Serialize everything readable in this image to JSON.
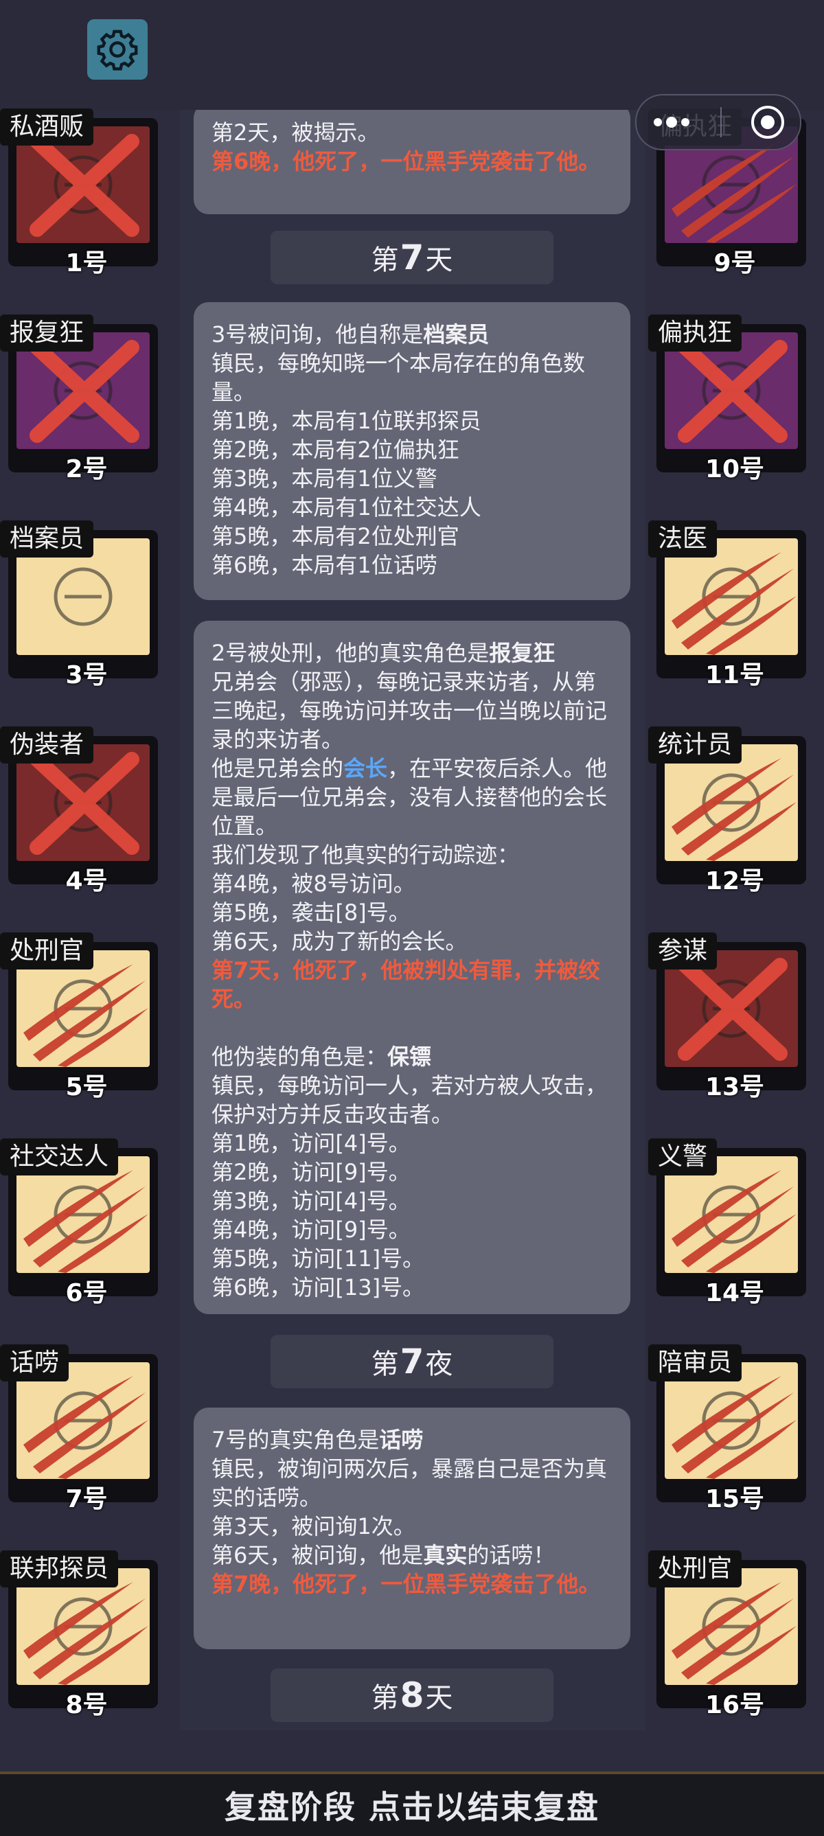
{
  "menu_capsule": {
    "more_icon": "more-dots-icon",
    "close_icon": "target-close-icon"
  },
  "settings_icon": "gear-icon",
  "log": {
    "msg_top": {
      "line1": "第2天，被揭示。",
      "line2": "第6晚，他死了，一位黑手党袭击了他。"
    },
    "day7_label": {
      "prefix": "第",
      "n": "7",
      "suffix": "天"
    },
    "msg_archivist": {
      "lines_a": "3号被问询，他自称是",
      "role": "档案员",
      "desc": "镇民，每晚知晓一个本局存在的角色数量。",
      "entries": [
        "第1晚，本局有1位联邦探员",
        "第2晚，本局有2位偏执狂",
        "第3晚，本局有1位义警",
        "第4晚，本局有1位社交达人",
        "第5晚，本局有2位处刑官",
        "第6晚，本局有1位话唠"
      ]
    },
    "msg_avenger": {
      "intro": "2号被处刑，他的真实角色是",
      "role": "报复狂",
      "desc": "兄弟会（邪恶），每晚记录来访者，从第三晚起，每晚访问并攻击一位当晚以前记录的来访者。",
      "leader_a": "他是兄弟会的",
      "leader_role": "会长",
      "leader_b": "，在平安夜后杀人。他是最后一位兄弟会，没有人接替他的会长位置。",
      "track_title": "我们发现了他真实的行动踪迹：",
      "track": [
        "第4晚，被8号访问。",
        "第5晚，袭击[8]号。",
        "第6天，成为了新的会长。"
      ],
      "death": "第7天，他死了，他被判处有罪，并被绞死。",
      "fake_intro": "他伪装的角色是：",
      "fake_role": "保镖",
      "fake_desc": "镇民，每晚访问一人，若对方被人攻击，保护对方并反击攻击者。",
      "fake_track": [
        "第1晚，访问[4]号。",
        "第2晚，访问[9]号。",
        "第3晚，访问[4]号。",
        "第4晚，访问[9]号。",
        "第5晚，访问[11]号。",
        "第6晚，访问[13]号。"
      ]
    },
    "night7_label": {
      "prefix": "第",
      "n": "7",
      "suffix": "夜"
    },
    "msg_chatter": {
      "intro": "7号的真实角色是",
      "role": "话唠",
      "desc": "镇民，被询问两次后，暴露自己是否为真实的话唠。",
      "line1": "第3天，被问询1次。",
      "line2a": "第6天，被问询，他是",
      "line2b": "真实",
      "line2c": "的话唠！",
      "death": "第7晚，他死了，一位黑手党袭击了他。"
    },
    "day8_label": {
      "prefix": "第",
      "n": "8",
      "suffix": "天"
    }
  },
  "players_left": [
    {
      "role": "私酒贩",
      "num": "1号",
      "bg": "maroon",
      "status": "crossed",
      "icon": "bootlegger-icon"
    },
    {
      "role": "报复狂",
      "num": "2号",
      "bg": "purple",
      "status": "crossed",
      "icon": "book-icon"
    },
    {
      "role": "档案员",
      "num": "3号",
      "bg": "cream",
      "status": "alive",
      "icon": "documents-icon"
    },
    {
      "role": "伪装者",
      "num": "4号",
      "bg": "maroon",
      "status": "crossed",
      "icon": "mask-icon"
    },
    {
      "role": "处刑官",
      "num": "5号",
      "bg": "cream",
      "status": "clawed",
      "icon": "axe-icon"
    },
    {
      "role": "社交达人",
      "num": "6号",
      "bg": "cream",
      "status": "clawed",
      "icon": "socialite-icon"
    },
    {
      "role": "话唠",
      "num": "7号",
      "bg": "cream",
      "status": "clawed",
      "icon": "chatter-icon"
    },
    {
      "role": "联邦探员",
      "num": "8号",
      "bg": "cream",
      "status": "clawed",
      "icon": "badge-icon"
    }
  ],
  "players_right": [
    {
      "role": "偏执狂",
      "num": "9号",
      "bg": "purple",
      "status": "clawed",
      "icon": "paranoid-icon"
    },
    {
      "role": "偏执狂",
      "num": "10号",
      "bg": "purple",
      "status": "crossed",
      "icon": "paranoid-icon"
    },
    {
      "role": "法医",
      "num": "11号",
      "bg": "cream",
      "status": "clawed",
      "icon": "mask-medical-icon"
    },
    {
      "role": "统计员",
      "num": "12号",
      "bg": "cream",
      "status": "clawed",
      "icon": "abacus-icon"
    },
    {
      "role": "参谋",
      "num": "13号",
      "bg": "maroon",
      "status": "crossed",
      "icon": "advisor-icon"
    },
    {
      "role": "义警",
      "num": "14号",
      "bg": "cream",
      "status": "clawed",
      "icon": "vigilante-icon"
    },
    {
      "role": "陪审员",
      "num": "15号",
      "bg": "cream",
      "status": "clawed",
      "icon": "juror-icon"
    },
    {
      "role": "处刑官",
      "num": "16号",
      "bg": "cream",
      "status": "clawed",
      "icon": "axe-icon"
    }
  ],
  "bottom": {
    "label": "复盘阶段 点击以结束复盘"
  },
  "colors": {
    "accent_red": "#f05a3d",
    "link_blue": "#59a8ff",
    "cream": "#f4dca2",
    "purple": "#6a2c6a",
    "maroon": "#7a2a2a"
  }
}
